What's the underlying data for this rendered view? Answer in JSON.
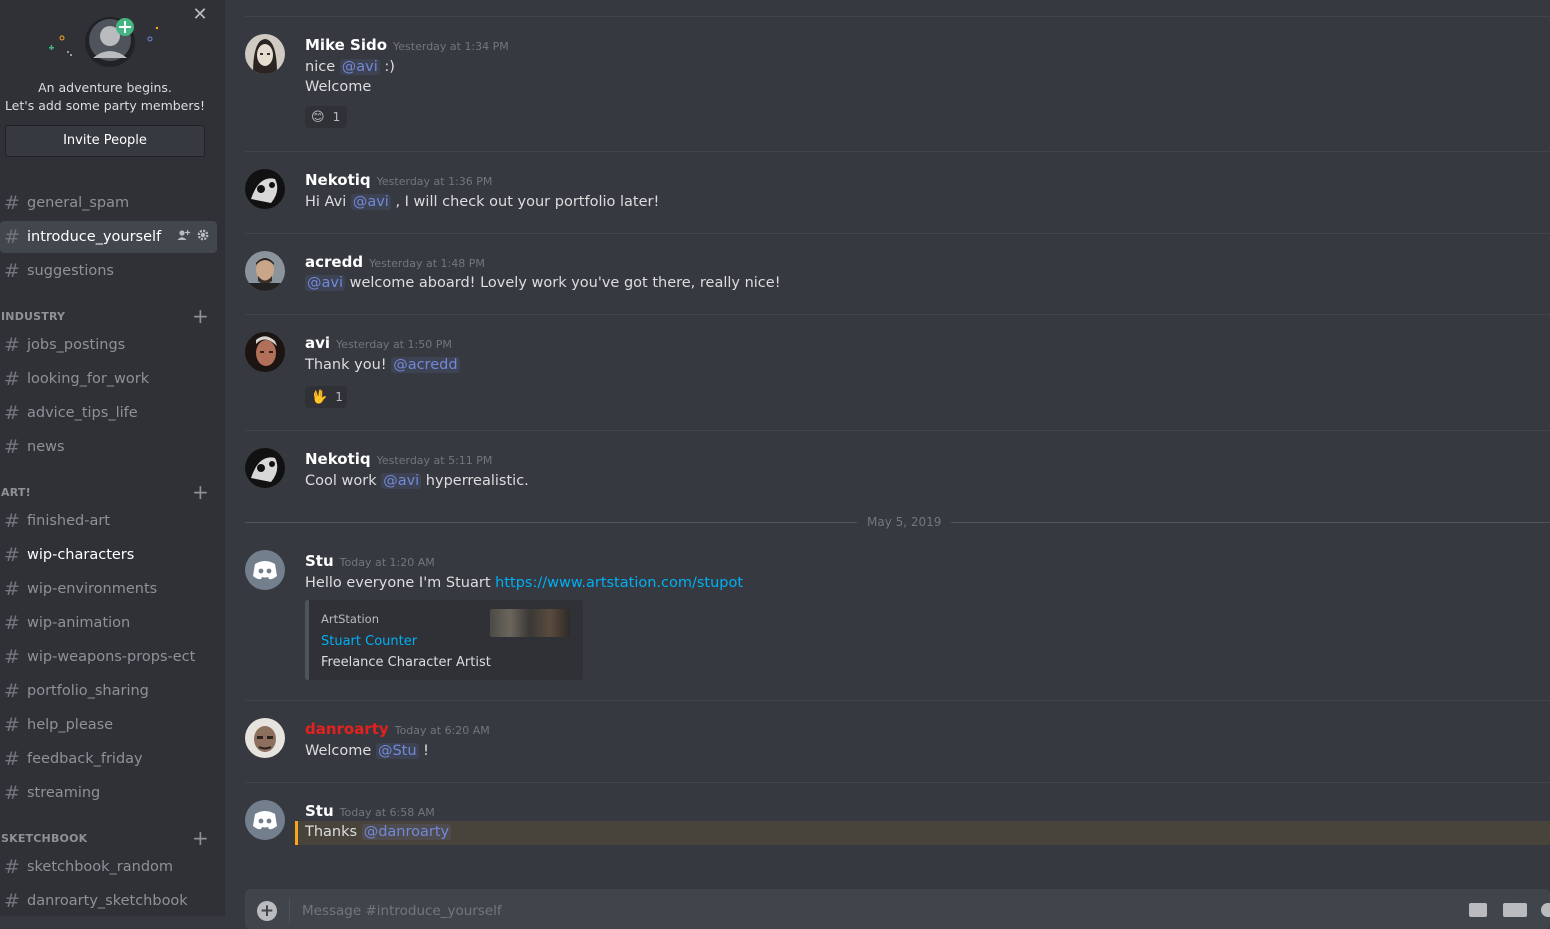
{
  "invite": {
    "close": "✕",
    "line1": "An adventure begins.",
    "line2": "Let's add some party members!",
    "button": "Invite People"
  },
  "channels": {
    "top": [
      {
        "name": "general_spam"
      },
      {
        "name": "introduce_yourself"
      },
      {
        "name": "suggestions"
      }
    ],
    "industry_label": "INDUSTRY",
    "industry": [
      {
        "name": "jobs_postings"
      },
      {
        "name": "looking_for_work"
      },
      {
        "name": "advice_tips_life"
      },
      {
        "name": "news"
      }
    ],
    "art_label": "ART!",
    "art": [
      {
        "name": "finished-art"
      },
      {
        "name": "wip-characters"
      },
      {
        "name": "wip-environments"
      },
      {
        "name": "wip-animation"
      },
      {
        "name": "wip-weapons-props-ect"
      },
      {
        "name": "portfolio_sharing"
      },
      {
        "name": "help_please"
      },
      {
        "name": "feedback_friday"
      },
      {
        "name": "streaming"
      }
    ],
    "sketchbook_label": "SKETCHBOOK",
    "sketchbook": [
      {
        "name": "sketchbook_random"
      },
      {
        "name": "danroarty_sketchbook"
      }
    ],
    "hash": "#",
    "plus": "+"
  },
  "messages": [
    {
      "author": "Mike Sido",
      "time": "Yesterday at 1:34 PM",
      "l1a": "nice ",
      "l1m": "@avi",
      "l1b": " :)",
      "l2": "Welcome",
      "reaction_emoji": "😊",
      "reaction_count": "1"
    },
    {
      "author": "Nekotiq",
      "time": "Yesterday at 1:36 PM",
      "l1a": "Hi Avi ",
      "l1m": "@avi",
      "l1b": " , I will check out your portfolio later!"
    },
    {
      "author": "acredd",
      "time": "Yesterday at 1:48 PM",
      "l1m": "@avi",
      "l1b": " welcome aboard!  Lovely work you've got there, really nice!"
    },
    {
      "author": "avi",
      "time": "Yesterday at 1:50 PM",
      "l1a": "Thank you!  ",
      "l1m": "@acredd",
      "reaction_emoji": "🖖",
      "reaction_count": "1"
    },
    {
      "author": "Nekotiq",
      "time": "Yesterday at 5:11 PM",
      "l1a": "Cool work ",
      "l1m": "@avi",
      "l1b": " hyperrealistic."
    },
    {
      "author": "Stu",
      "time": "Today at 1:20 AM",
      "l1a": "Hello everyone I'm Stuart ",
      "link": "https://www.artstation.com/stupot",
      "embed": {
        "provider": "ArtStation",
        "title": "Stuart Counter",
        "description": "Freelance Character Artist"
      }
    },
    {
      "author": "danroarty",
      "time": "Today at 6:20 AM",
      "l1a": "Welcome ",
      "l1m": "@Stu",
      "l1b": " !"
    },
    {
      "author": "Stu",
      "time": "Today at 6:58 AM",
      "l1a": "Thanks  ",
      "l1m": "@danroarty"
    }
  ],
  "date_divider": "May 5, 2019",
  "composer": {
    "placeholder": "Message #introduce_yourself"
  },
  "colors": {
    "accent": "#7289da",
    "link": "#00b0f4",
    "danroarty": "#e5201d",
    "highlight": "#faa61a"
  }
}
